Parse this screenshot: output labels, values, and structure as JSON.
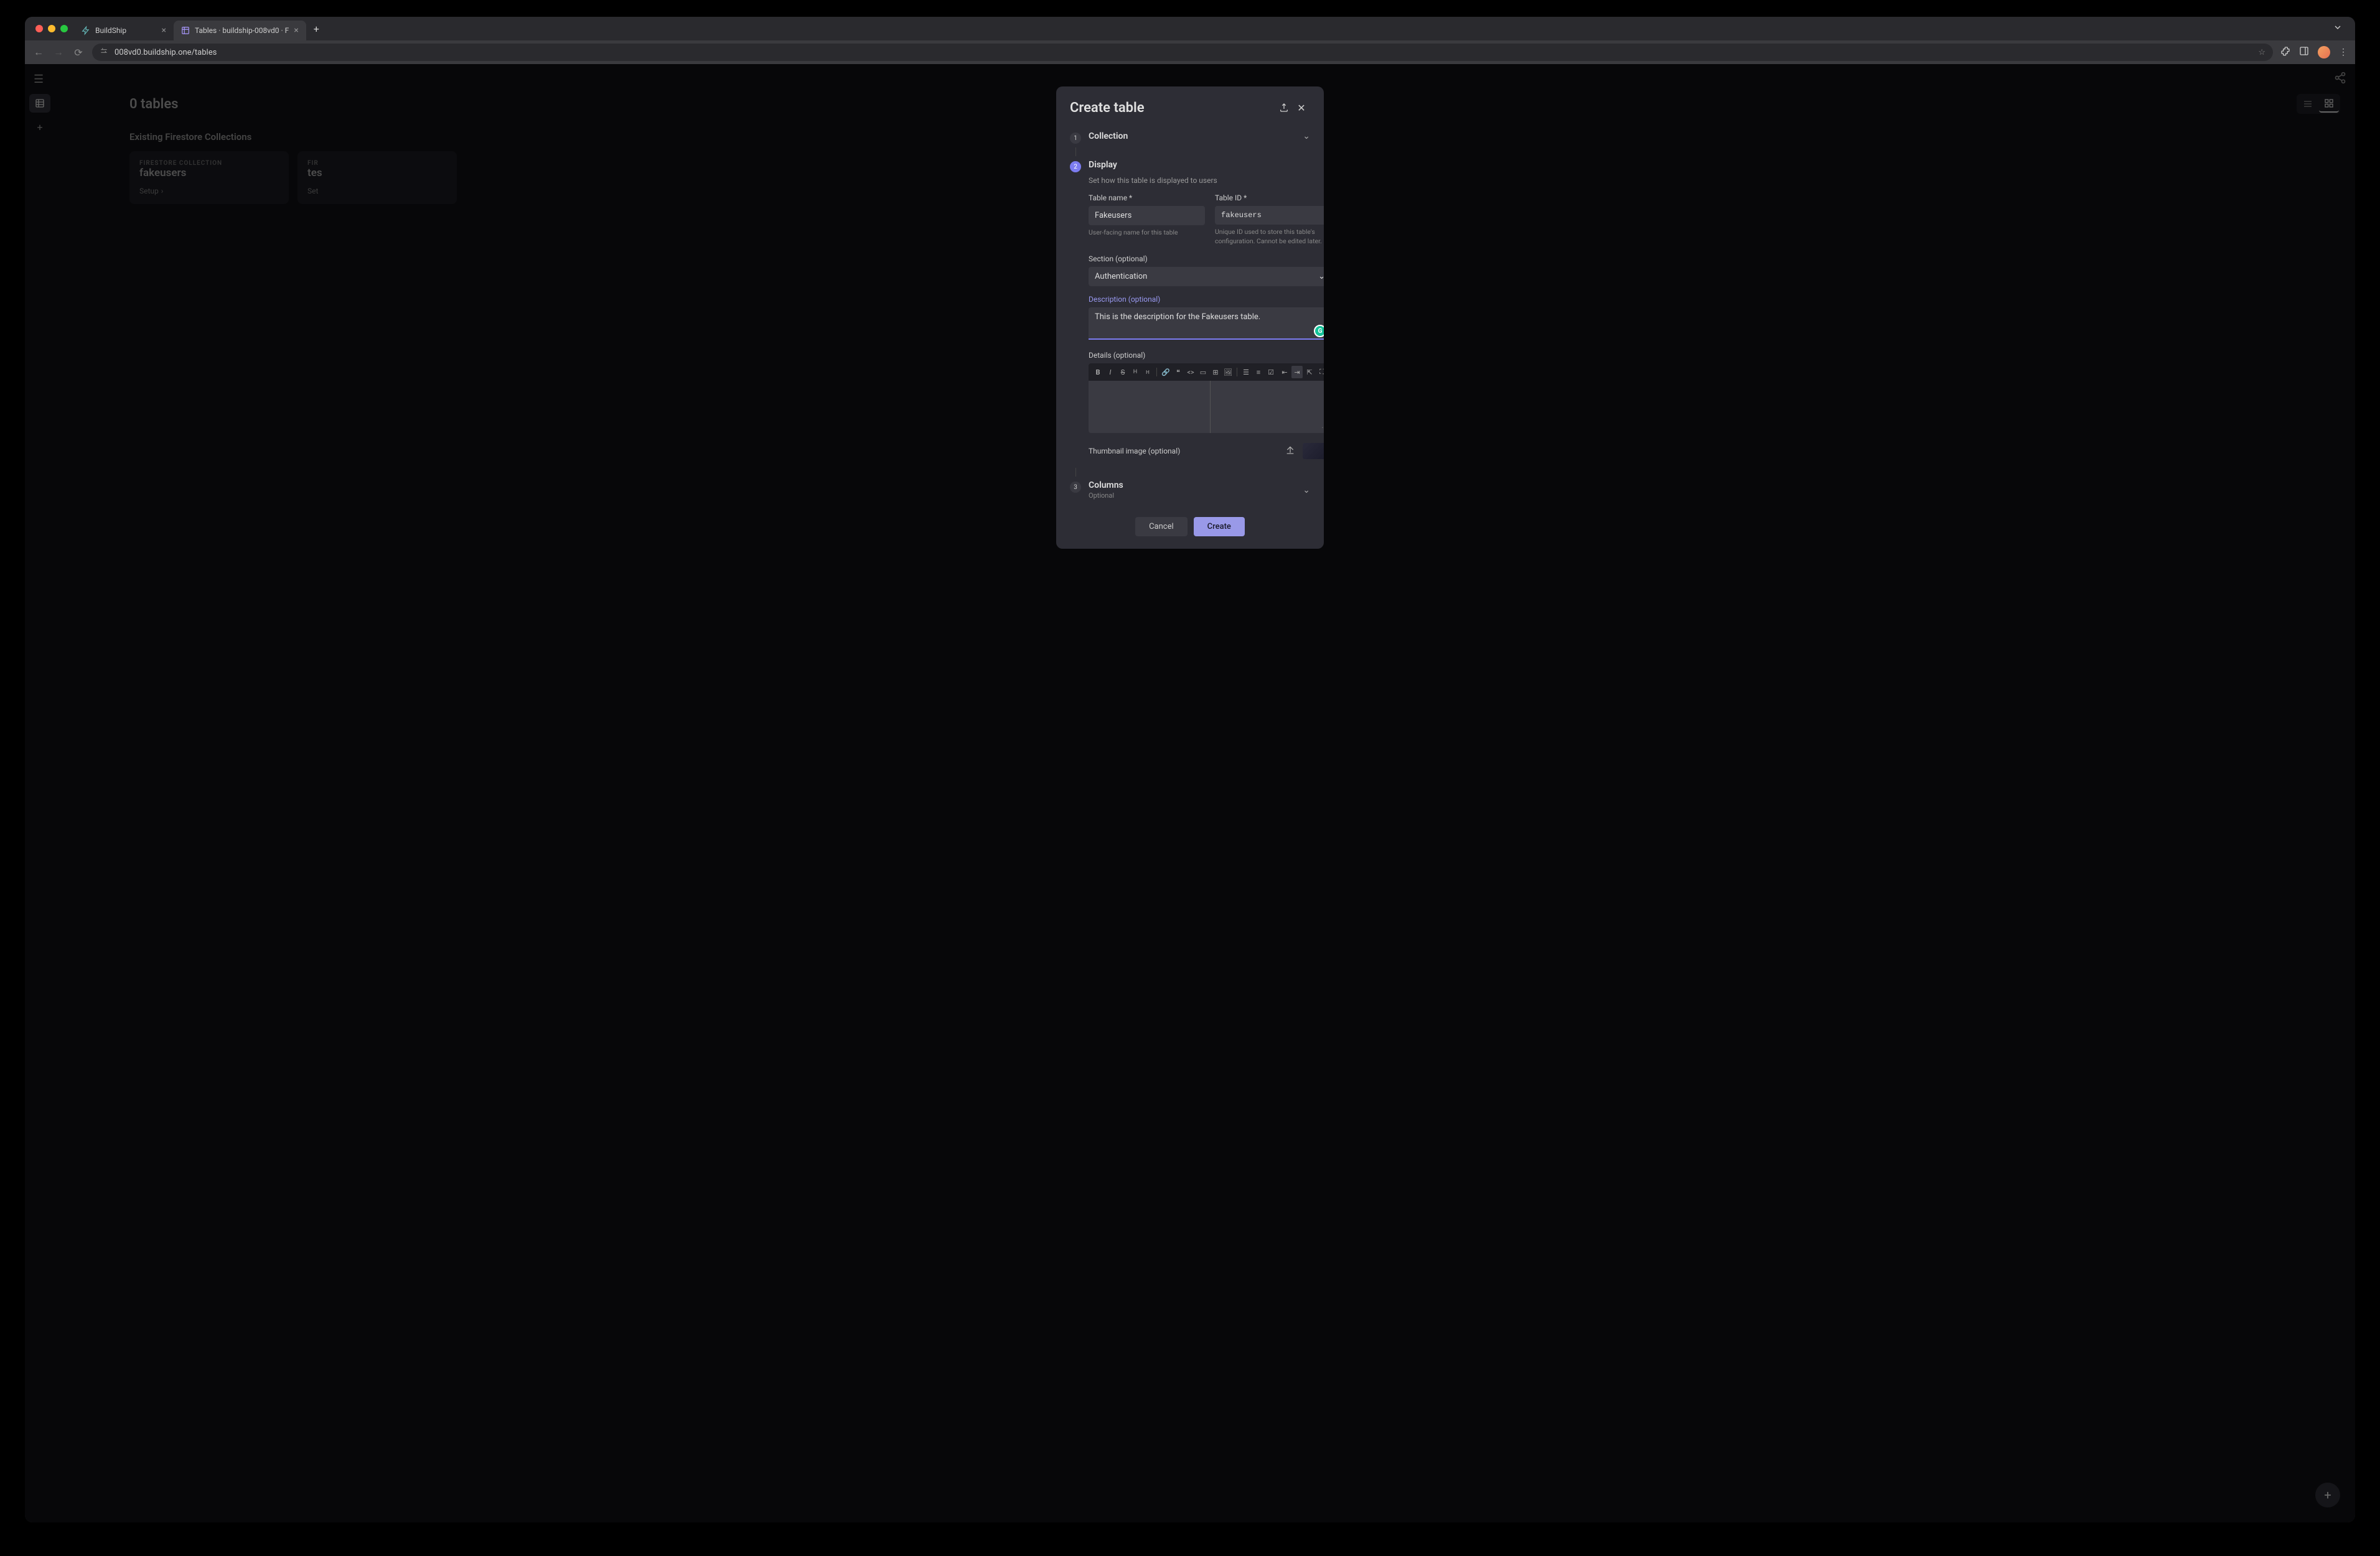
{
  "browser": {
    "tabs": [
      {
        "title": "BuildShip",
        "active": false
      },
      {
        "title": "Tables · buildship-008vd0 · F",
        "active": true
      }
    ],
    "url": "008vd0.buildship.one/tables"
  },
  "app": {
    "tablesTitle": "0 tables",
    "sectionLabel": "Existing Firestore Collections",
    "collections": [
      {
        "label": "FIRESTORE COLLECTION",
        "name": "fakeusers",
        "setup": "Setup"
      },
      {
        "label": "FIR",
        "name": "tes",
        "setup": "Set"
      }
    ]
  },
  "modal": {
    "title": "Create table",
    "steps": {
      "collection": {
        "num": "1",
        "title": "Collection"
      },
      "display": {
        "num": "2",
        "title": "Display",
        "desc": "Set how this table is displayed to users",
        "tableName": {
          "label": "Table name *",
          "value": "Fakeusers",
          "help": "User-facing name for this table"
        },
        "tableId": {
          "label": "Table ID *",
          "value": "fakeusers",
          "help": "Unique ID used to store this table's configuration. Cannot be edited later."
        },
        "section": {
          "label": "Section (optional)",
          "value": "Authentication"
        },
        "description": {
          "label": "Description (optional)",
          "value": "This is the description for the Fakeusers table."
        },
        "details": {
          "label": "Details (optional)"
        },
        "thumbnail": {
          "label": "Thumbnail image (optional)"
        }
      },
      "columns": {
        "num": "3",
        "title": "Columns",
        "sub": "Optional"
      }
    },
    "buttons": {
      "cancel": "Cancel",
      "create": "Create"
    }
  }
}
